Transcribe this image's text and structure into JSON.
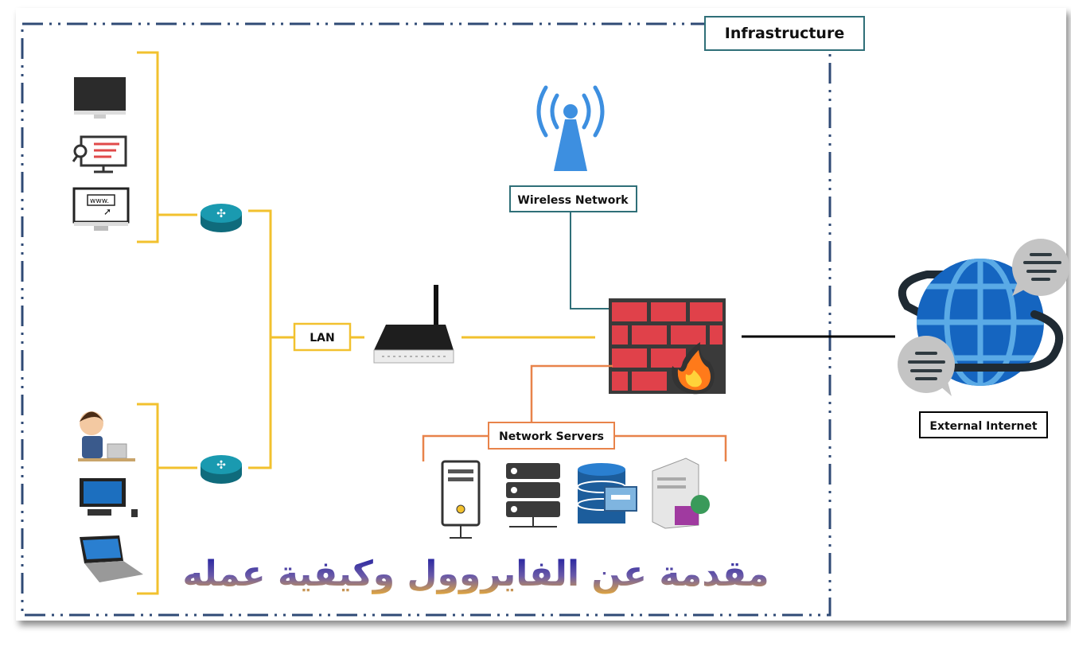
{
  "title": "مقدمة عن الفايروول وكيفية عمله",
  "labels": {
    "infrastructure": "Infrastructure",
    "wireless": "Wireless Network",
    "lan": "LAN",
    "servers": "Network Servers",
    "internet": "External Internet"
  },
  "monitor_text": "www.",
  "colors": {
    "border": "#2f4a75",
    "lan_links": "#f2c12e",
    "server_links": "#e8834a",
    "wireless_link": "#2f6f78",
    "internet_link": "#000000",
    "firewall": "#d9383f",
    "globe": "#1565c0"
  }
}
